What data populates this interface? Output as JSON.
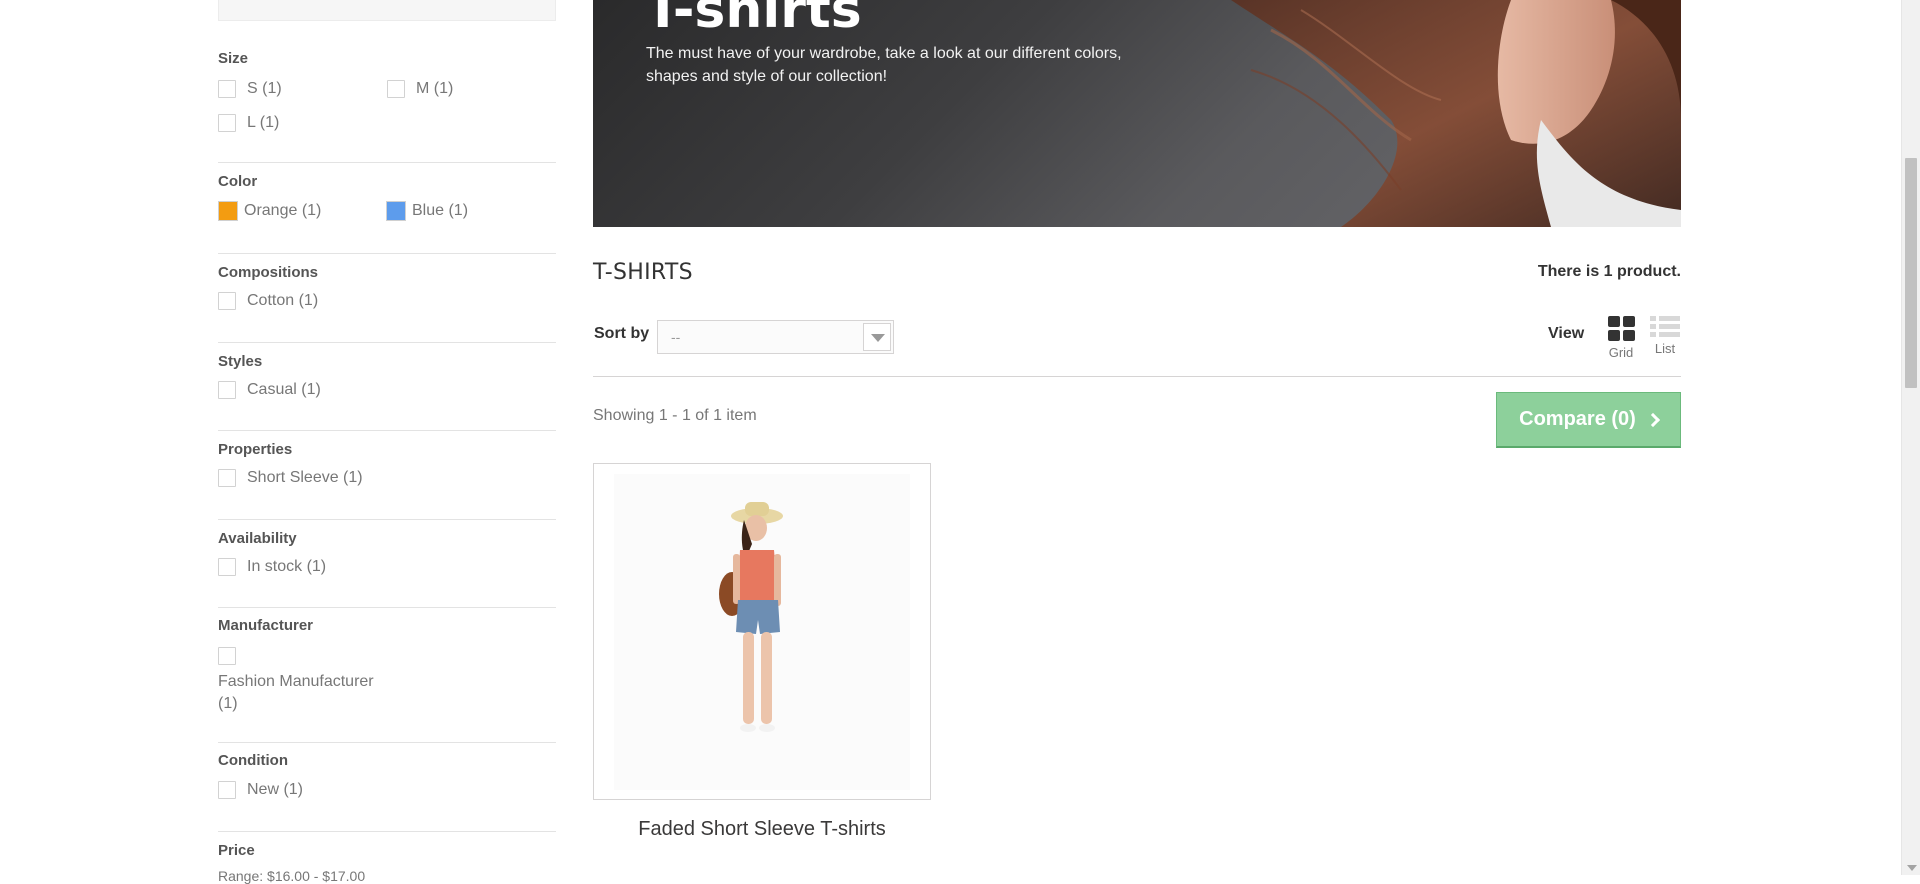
{
  "sidebar": {
    "size": {
      "title": "Size",
      "options": [
        {
          "label": "S (1)"
        },
        {
          "label": "M (1)"
        },
        {
          "label": "L (1)"
        }
      ]
    },
    "color": {
      "title": "Color",
      "options": [
        {
          "label": "Orange (1)",
          "swatch": "#f39c11"
        },
        {
          "label": "Blue (1)",
          "swatch": "#5d9cec"
        }
      ]
    },
    "compositions": {
      "title": "Compositions",
      "options": [
        {
          "label": "Cotton (1)"
        }
      ]
    },
    "styles": {
      "title": "Styles",
      "options": [
        {
          "label": "Casual (1)"
        }
      ]
    },
    "properties": {
      "title": "Properties",
      "options": [
        {
          "label": "Short Sleeve (1)"
        }
      ]
    },
    "availability": {
      "title": "Availability",
      "options": [
        {
          "label": "In stock (1)"
        }
      ]
    },
    "manufacturer": {
      "title": "Manufacturer",
      "options": [
        {
          "label_line1": "Fashion Manufacturer",
          "label_line2": "(1)"
        }
      ]
    },
    "condition": {
      "title": "Condition",
      "options": [
        {
          "label": "New (1)"
        }
      ]
    },
    "price": {
      "title": "Price",
      "range": "Range: $16.00 - $17.00"
    }
  },
  "banner": {
    "title": "T-shirts",
    "description": "The must have of your wardrobe, take a look at our different colors, shapes and style of our collection!"
  },
  "category": {
    "heading": "T-SHIRTS",
    "product_count": "There is 1 product."
  },
  "toolbar": {
    "sort_label": "Sort by",
    "sort_value": "--",
    "view_label": "View",
    "view_grid": "Grid",
    "view_list": "List",
    "showing": "Showing 1 - 1 of 1 item",
    "compare_label": "Compare (0)"
  },
  "products": [
    {
      "name": "Faded Short Sleeve T-shirts"
    }
  ]
}
